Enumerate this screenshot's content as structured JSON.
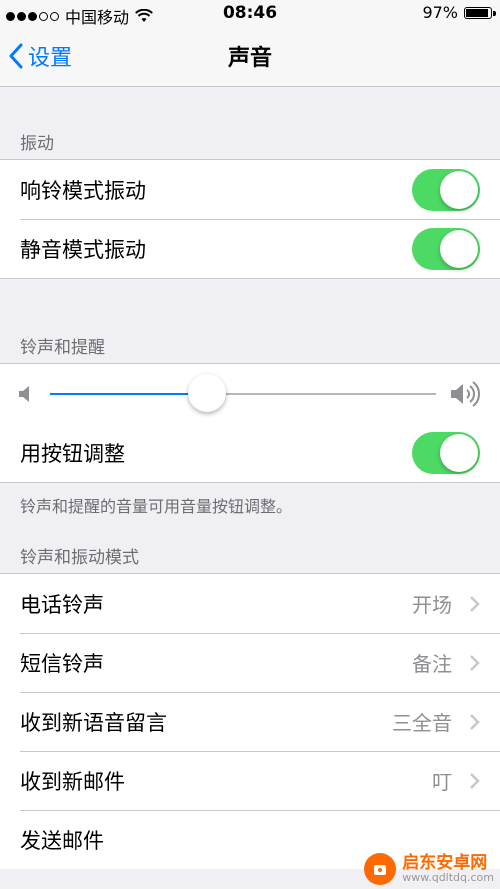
{
  "status_bar": {
    "carrier": "中国移动",
    "time": "08:46",
    "battery": "97%",
    "battery_level": 0.97
  },
  "nav": {
    "back_label": "设置",
    "title": "声音"
  },
  "vibration": {
    "header": "振动",
    "items": [
      {
        "label": "响铃模式振动",
        "on": true
      },
      {
        "label": "静音模式振动",
        "on": true
      }
    ]
  },
  "ringer": {
    "header": "铃声和提醒",
    "volume_level": 0.42,
    "adjust_label": "用按钮调整",
    "adjust_on": true,
    "footer": "铃声和提醒的音量可用音量按钮调整。"
  },
  "patterns": {
    "header": "铃声和振动模式",
    "items": [
      {
        "label": "电话铃声",
        "value": "开场"
      },
      {
        "label": "短信铃声",
        "value": "备注"
      },
      {
        "label": "收到新语音留言",
        "value": "三全音"
      },
      {
        "label": "收到新邮件",
        "value": "叮"
      },
      {
        "label": "发送邮件",
        "value": ""
      }
    ]
  },
  "watermark": {
    "name": "启东安卓网",
    "url": "www.qdltdq.com"
  },
  "colors": {
    "accent": "#007aff",
    "toggle_on": "#4cd964",
    "background": "#efeff4"
  }
}
